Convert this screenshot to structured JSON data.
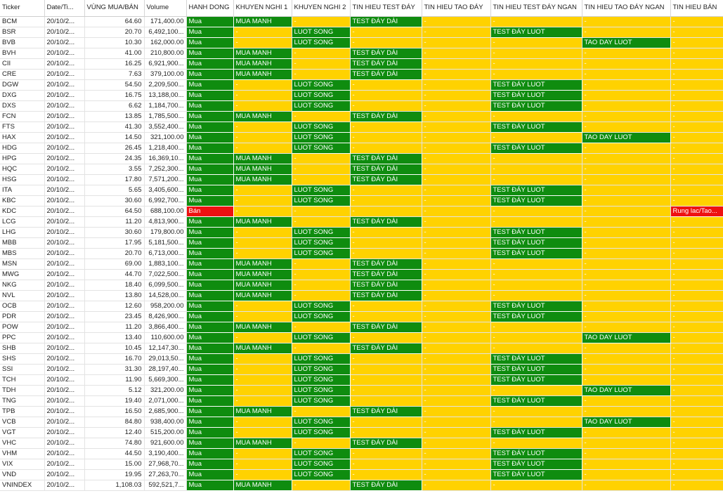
{
  "colors": {
    "green": "#0F8C0F",
    "yellow": "#FFD200",
    "red": "#EE1111"
  },
  "columns": [
    "Ticker",
    "Date/Ti...",
    "VÙNG MUA/BÁN",
    "Volume",
    "HANH DONG",
    "KHUYEN NGHI 1",
    "KHUYEN NGHI 2",
    "TIN HIEU TEST ĐÁY",
    "TIN HIEU TAO ĐÁY",
    "TIN HIEU TEST ĐÁY NGAN",
    "TIN HIEU TAO ĐÁY NGAN",
    "TIN HIEU BÁN"
  ],
  "rows": [
    [
      "BCM",
      "20/10/2...",
      "64.60",
      "171,400.00",
      "Mua",
      "MUA MANH",
      "-",
      "TEST ĐÁY DÀI",
      "-",
      "-",
      "-",
      "-"
    ],
    [
      "BSR",
      "20/10/2...",
      "20.70",
      "6,492,100...",
      "Mua",
      "-",
      "LUOT SONG",
      "-",
      "-",
      "TEST ĐÁY LUOT",
      "-",
      "-"
    ],
    [
      "BVB",
      "20/10/2...",
      "10.30",
      "162,000.00",
      "Mua",
      "-",
      "LUOT SONG",
      "-",
      "-",
      "-",
      "TAO DAY LUOT",
      "-"
    ],
    [
      "BVH",
      "20/10/2...",
      "41.00",
      "210,800.00",
      "Mua",
      "MUA MANH",
      "-",
      "TEST ĐÁY DÀI",
      "-",
      "-",
      "-",
      "-"
    ],
    [
      "CII",
      "20/10/2...",
      "16.25",
      "6,921,900...",
      "Mua",
      "MUA MANH",
      "-",
      "TEST ĐÁY DÀI",
      "-",
      "-",
      "-",
      "-"
    ],
    [
      "CRE",
      "20/10/2...",
      "7.63",
      "379,100.00",
      "Mua",
      "MUA MANH",
      "-",
      "TEST ĐÁY DÀI",
      "-",
      "-",
      "-",
      "-"
    ],
    [
      "DGW",
      "20/10/2...",
      "54.50",
      "2,209,500...",
      "Mua",
      "-",
      "LUOT SONG",
      "-",
      "-",
      "TEST ĐÁY LUOT",
      "-",
      "-"
    ],
    [
      "DXG",
      "20/10/2...",
      "16.75",
      "13,188,00...",
      "Mua",
      "-",
      "LUOT SONG",
      "-",
      "-",
      "TEST ĐÁY LUOT",
      "-",
      "-"
    ],
    [
      "DXS",
      "20/10/2...",
      "6.62",
      "1,184,700...",
      "Mua",
      "-",
      "LUOT SONG",
      "-",
      "-",
      "TEST ĐÁY LUOT",
      "-",
      "-"
    ],
    [
      "FCN",
      "20/10/2...",
      "13.85",
      "1,785,500...",
      "Mua",
      "MUA MANH",
      "-",
      "TEST ĐÁY DÀI",
      "-",
      "-",
      "-",
      "-"
    ],
    [
      "FTS",
      "20/10/2...",
      "41.30",
      "3,552,400...",
      "Mua",
      "-",
      "LUOT SONG",
      "-",
      "-",
      "TEST ĐÁY LUOT",
      "-",
      "-"
    ],
    [
      "HAX",
      "20/10/2...",
      "14.50",
      "321,100.00",
      "Mua",
      "-",
      "LUOT SONG",
      "-",
      "-",
      "-",
      "TAO DAY LUOT",
      "-"
    ],
    [
      "HDG",
      "20/10/2...",
      "26.45",
      "1,218,400...",
      "Mua",
      "-",
      "LUOT SONG",
      "-",
      "-",
      "TEST ĐÁY LUOT",
      "-",
      "-"
    ],
    [
      "HPG",
      "20/10/2...",
      "24.35",
      "16,369,10...",
      "Mua",
      "MUA MANH",
      "-",
      "TEST ĐÁY DÀI",
      "-",
      "-",
      "-",
      "-"
    ],
    [
      "HQC",
      "20/10/2...",
      "3.55",
      "7,252,300...",
      "Mua",
      "MUA MANH",
      "-",
      "TEST ĐÁY DÀI",
      "-",
      "-",
      "-",
      "-"
    ],
    [
      "HSG",
      "20/10/2...",
      "17.80",
      "7,571,200...",
      "Mua",
      "MUA MANH",
      "-",
      "TEST ĐÁY DÀI",
      "-",
      "-",
      "-",
      "-"
    ],
    [
      "ITA",
      "20/10/2...",
      "5.65",
      "3,405,600...",
      "Mua",
      "-",
      "LUOT SONG",
      "-",
      "-",
      "TEST ĐÁY LUOT",
      "-",
      "-"
    ],
    [
      "KBC",
      "20/10/2...",
      "30.60",
      "6,992,700...",
      "Mua",
      "-",
      "LUOT SONG",
      "-",
      "-",
      "TEST ĐÁY LUOT",
      "-",
      "-"
    ],
    [
      "KDC",
      "20/10/2...",
      "64.50",
      "688,100.00",
      "Bán",
      "-",
      "-",
      "-",
      "-",
      "-",
      "-",
      "Rung lac/Tao..."
    ],
    [
      "LCG",
      "20/10/2...",
      "11.20",
      "4,813,900...",
      "Mua",
      "MUA MANH",
      "-",
      "TEST ĐÁY DÀI",
      "-",
      "-",
      "-",
      "-"
    ],
    [
      "LHG",
      "20/10/2...",
      "30.60",
      "179,800.00",
      "Mua",
      "-",
      "LUOT SONG",
      "-",
      "-",
      "TEST ĐÁY LUOT",
      "-",
      "-"
    ],
    [
      "MBB",
      "20/10/2...",
      "17.95",
      "5,181,500...",
      "Mua",
      "-",
      "LUOT SONG",
      "-",
      "-",
      "TEST ĐÁY LUOT",
      "-",
      "-"
    ],
    [
      "MBS",
      "20/10/2...",
      "20.70",
      "6,713,000...",
      "Mua",
      "-",
      "LUOT SONG",
      "-",
      "-",
      "TEST ĐÁY LUOT",
      "-",
      "-"
    ],
    [
      "MSN",
      "20/10/2...",
      "69.00",
      "1,883,100...",
      "Mua",
      "MUA MANH",
      "-",
      "TEST ĐÁY DÀI",
      "-",
      "-",
      "-",
      "-"
    ],
    [
      "MWG",
      "20/10/2...",
      "44.70",
      "7,022,500...",
      "Mua",
      "MUA MANH",
      "-",
      "TEST ĐÁY DÀI",
      "-",
      "-",
      "-",
      "-"
    ],
    [
      "NKG",
      "20/10/2...",
      "18.40",
      "6,099,500...",
      "Mua",
      "MUA MANH",
      "-",
      "TEST ĐÁY DÀI",
      "-",
      "-",
      "-",
      "-"
    ],
    [
      "NVL",
      "20/10/2...",
      "13.80",
      "14,528,00...",
      "Mua",
      "MUA MANH",
      "-",
      "TEST ĐÁY DÀI",
      "-",
      "-",
      "-",
      "-"
    ],
    [
      "OCB",
      "20/10/2...",
      "12.60",
      "958,200.00",
      "Mua",
      "-",
      "LUOT SONG",
      "-",
      "-",
      "TEST ĐÁY LUOT",
      "-",
      "-"
    ],
    [
      "PDR",
      "20/10/2...",
      "23.45",
      "8,426,900...",
      "Mua",
      "-",
      "LUOT SONG",
      "-",
      "-",
      "TEST ĐÁY LUOT",
      "-",
      "-"
    ],
    [
      "POW",
      "20/10/2...",
      "11.20",
      "3,866,400...",
      "Mua",
      "MUA MANH",
      "-",
      "TEST ĐÁY DÀI",
      "-",
      "-",
      "-",
      "-"
    ],
    [
      "PPC",
      "20/10/2...",
      "13.40",
      "110,600.00",
      "Mua",
      "-",
      "LUOT SONG",
      "-",
      "-",
      "-",
      "TAO DAY LUOT",
      "-"
    ],
    [
      "SHB",
      "20/10/2...",
      "10.45",
      "12,147,30...",
      "Mua",
      "MUA MANH",
      "-",
      "TEST ĐÁY DÀI",
      "-",
      "-",
      "-",
      "-"
    ],
    [
      "SHS",
      "20/10/2...",
      "16.70",
      "29,013,50...",
      "Mua",
      "-",
      "LUOT SONG",
      "-",
      "-",
      "TEST ĐÁY LUOT",
      "-",
      "-"
    ],
    [
      "SSI",
      "20/10/2...",
      "31.30",
      "28,197,40...",
      "Mua",
      "-",
      "LUOT SONG",
      "-",
      "-",
      "TEST ĐÁY LUOT",
      "-",
      "-"
    ],
    [
      "TCH",
      "20/10/2...",
      "11.90",
      "5,669,300...",
      "Mua",
      "-",
      "LUOT SONG",
      "-",
      "-",
      "TEST ĐÁY LUOT",
      "-",
      "-"
    ],
    [
      "TDH",
      "20/10/2...",
      "5.12",
      "321,200.00",
      "Mua",
      "-",
      "LUOT SONG",
      "-",
      "-",
      "-",
      "TAO DAY LUOT",
      "-"
    ],
    [
      "TNG",
      "20/10/2...",
      "19.40",
      "2,071,000...",
      "Mua",
      "-",
      "LUOT SONG",
      "-",
      "-",
      "TEST ĐÁY LUOT",
      "-",
      "-"
    ],
    [
      "TPB",
      "20/10/2...",
      "16.50",
      "2,685,900...",
      "Mua",
      "MUA MANH",
      "-",
      "TEST ĐÁY DÀI",
      "-",
      "-",
      "-",
      "-"
    ],
    [
      "VCB",
      "20/10/2...",
      "84.80",
      "938,400.00",
      "Mua",
      "-",
      "LUOT SONG",
      "-",
      "-",
      "-",
      "TAO DAY LUOT",
      "-"
    ],
    [
      "VGT",
      "20/10/2...",
      "12.40",
      "515,200.00",
      "Mua",
      "-",
      "LUOT SONG",
      "-",
      "-",
      "TEST ĐÁY LUOT",
      "-",
      "-"
    ],
    [
      "VHC",
      "20/10/2...",
      "74.80",
      "921,600.00",
      "Mua",
      "MUA MANH",
      "-",
      "TEST ĐÁY DÀI",
      "-",
      "-",
      "-",
      "-"
    ],
    [
      "VHM",
      "20/10/2...",
      "44.50",
      "3,190,400...",
      "Mua",
      "-",
      "LUOT SONG",
      "-",
      "-",
      "TEST ĐÁY LUOT",
      "-",
      "-"
    ],
    [
      "VIX",
      "20/10/2...",
      "15.00",
      "27,968,70...",
      "Mua",
      "-",
      "LUOT SONG",
      "-",
      "-",
      "TEST ĐÁY LUOT",
      "-",
      "-"
    ],
    [
      "VND",
      "20/10/2...",
      "19.95",
      "27,263,70...",
      "Mua",
      "-",
      "LUOT SONG",
      "-",
      "-",
      "TEST ĐÁY LUOT",
      "-",
      "-"
    ],
    [
      "VNINDEX",
      "20/10/2...",
      "1,108.03",
      "592,521,7...",
      "Mua",
      "MUA MANH",
      "-",
      "TEST ĐÁY DÀI",
      "-",
      "-",
      "-",
      "-"
    ]
  ]
}
